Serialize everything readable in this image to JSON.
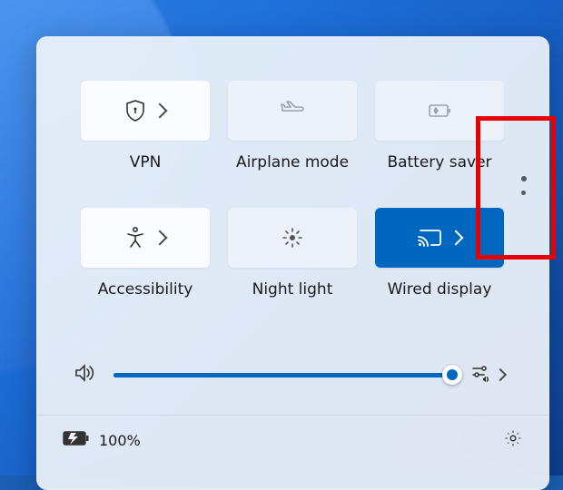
{
  "accent": "#0067c0",
  "tiles": {
    "vpn": {
      "label": "VPN",
      "active": false,
      "disabled": false,
      "has_arrow": true
    },
    "airplane": {
      "label": "Airplane mode",
      "active": false,
      "disabled": true,
      "has_arrow": false
    },
    "battery": {
      "label": "Battery saver",
      "active": false,
      "disabled": true,
      "has_arrow": false
    },
    "access": {
      "label": "Accessibility",
      "active": false,
      "disabled": false,
      "has_arrow": true
    },
    "nightlight": {
      "label": "Night light",
      "active": false,
      "disabled": false,
      "has_arrow": false
    },
    "cast": {
      "label": "Wired display",
      "active": true,
      "disabled": false,
      "has_arrow": true
    }
  },
  "volume": {
    "percent": 100
  },
  "footer": {
    "battery_text": "100%"
  }
}
